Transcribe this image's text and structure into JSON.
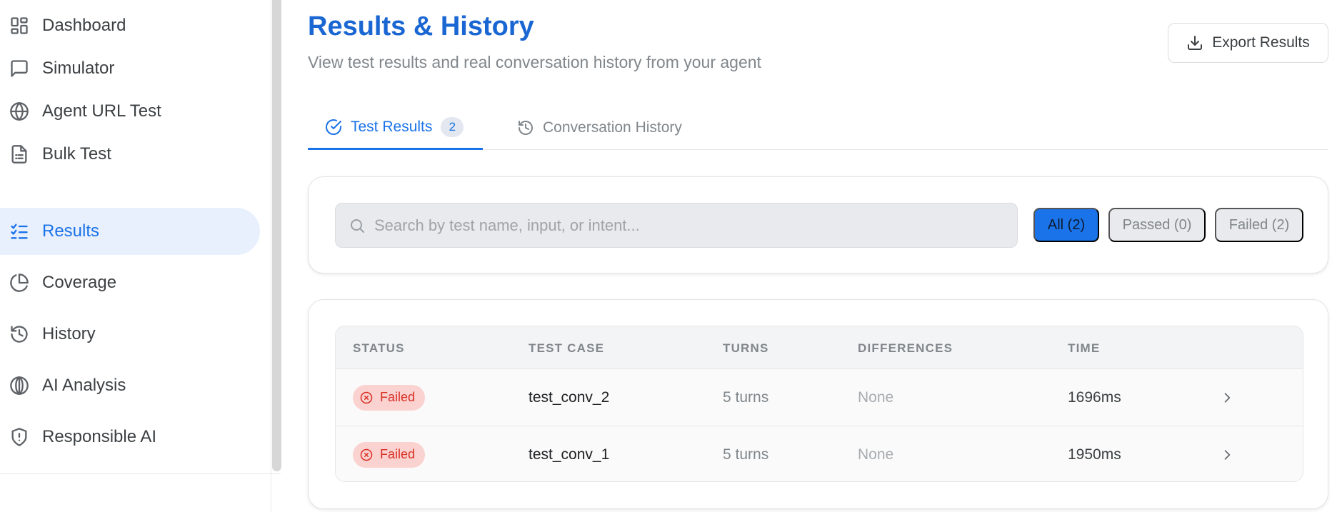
{
  "sidebar": {
    "items": [
      {
        "label": "Dashboard",
        "icon": "dashboard-icon"
      },
      {
        "label": "Simulator",
        "icon": "chat-bubble-icon"
      },
      {
        "label": "Agent URL Test",
        "icon": "globe-icon"
      },
      {
        "label": "Bulk Test",
        "icon": "document-list-icon"
      },
      {
        "label": "Results",
        "icon": "checklist-icon",
        "active": true
      },
      {
        "label": "Coverage",
        "icon": "pie-chart-icon"
      },
      {
        "label": "History",
        "icon": "history-icon"
      },
      {
        "label": "AI Analysis",
        "icon": "brain-icon"
      },
      {
        "label": "Responsible AI",
        "icon": "shield-icon"
      }
    ]
  },
  "header": {
    "title": "Results & History",
    "subtitle": "View test results and real conversation history from your agent",
    "export_label": "Export Results"
  },
  "tabs": {
    "results_label": "Test Results",
    "results_count": "2",
    "history_label": "Conversation History"
  },
  "search": {
    "placeholder": "Search by test name, input, or intent..."
  },
  "filters": {
    "all": "All (2)",
    "passed": "Passed (0)",
    "failed": "Failed (2)"
  },
  "table": {
    "headers": {
      "status": "STATUS",
      "test_case": "TEST CASE",
      "turns": "TURNS",
      "differences": "DIFFERENCES",
      "time": "TIME"
    },
    "rows": [
      {
        "status": "Failed",
        "test_case": "test_conv_2",
        "turns": "5 turns",
        "differences": "None",
        "time": "1696ms"
      },
      {
        "status": "Failed",
        "test_case": "test_conv_1",
        "turns": "5 turns",
        "differences": "None",
        "time": "1950ms"
      }
    ]
  },
  "colors": {
    "accent": "#1a73e8",
    "title": "#1a66d2",
    "failed": "#d93025",
    "failed_bg": "#fad2d0"
  }
}
